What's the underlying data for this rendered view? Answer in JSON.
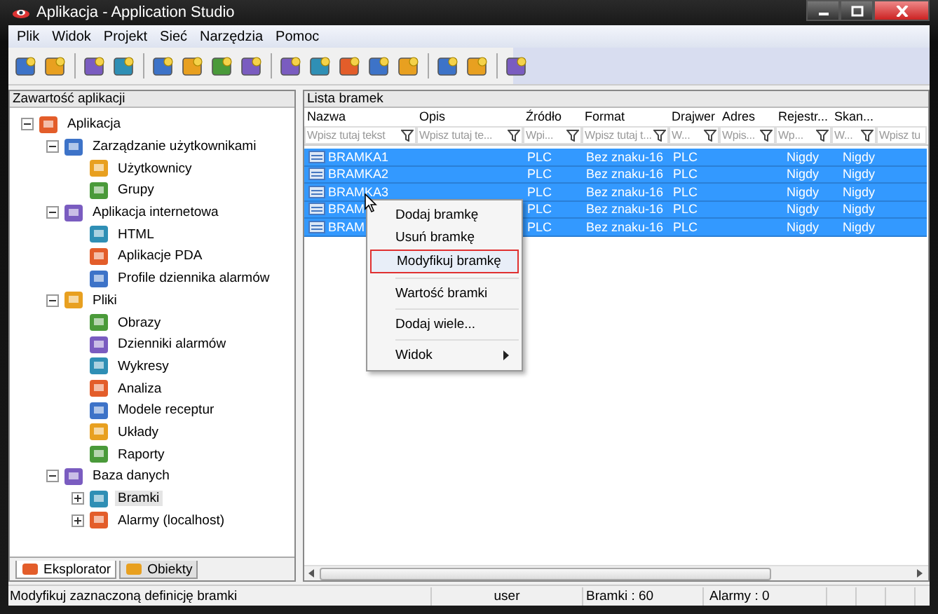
{
  "window": {
    "title": "Aplikacja - Application Studio"
  },
  "menu": [
    "Plik",
    "Widok",
    "Projekt",
    "Sieć",
    "Narzędzia",
    "Pomoc"
  ],
  "explorer": {
    "title": "Zawartość aplikacji",
    "tree": [
      {
        "label": "Aplikacja",
        "expanded": true,
        "selected": false,
        "children": [
          {
            "label": "Zarządzanie użytkownikami",
            "expanded": true,
            "selected": false,
            "children": [
              {
                "label": "Użytkownicy",
                "selected": false
              },
              {
                "label": "Grupy",
                "selected": false
              }
            ]
          },
          {
            "label": "Aplikacja internetowa",
            "expanded": true,
            "selected": false,
            "children": [
              {
                "label": "HTML",
                "selected": false
              },
              {
                "label": "Aplikacje PDA",
                "selected": false
              },
              {
                "label": "Profile dziennika alarmów",
                "selected": false
              }
            ]
          },
          {
            "label": "Pliki",
            "expanded": true,
            "selected": false,
            "children": [
              {
                "label": "Obrazy",
                "selected": false
              },
              {
                "label": "Dzienniki alarmów",
                "selected": false
              },
              {
                "label": "Wykresy",
                "selected": false
              },
              {
                "label": "Analiza",
                "selected": false
              },
              {
                "label": "Modele receptur",
                "selected": false
              },
              {
                "label": "Układy",
                "selected": false
              },
              {
                "label": "Raporty",
                "selected": false
              }
            ]
          },
          {
            "label": "Baza danych",
            "expanded": true,
            "selected": false,
            "children": [
              {
                "label": "Bramki",
                "expanded": false,
                "selected": true
              },
              {
                "label": "Alarmy (localhost)",
                "expanded": false,
                "selected": false
              }
            ]
          }
        ]
      }
    ],
    "tabs": [
      {
        "label": "Eksplorator",
        "selected": true
      },
      {
        "label": "Obiekty",
        "selected": false
      }
    ]
  },
  "grid": {
    "title": "Lista bramek",
    "columns": [
      {
        "label": "Nazwa",
        "placeholder": "Wpisz tutaj tekst"
      },
      {
        "label": "Opis",
        "placeholder": "Wpisz tutaj te..."
      },
      {
        "label": "Źródło",
        "placeholder": "Wpi..."
      },
      {
        "label": "Format",
        "placeholder": "Wpisz tutaj t..."
      },
      {
        "label": "Drajwer",
        "placeholder": "W..."
      },
      {
        "label": "Adres",
        "placeholder": "Wpis..."
      },
      {
        "label": "Rejestr...",
        "placeholder": "Wp..."
      },
      {
        "label": "Skan...",
        "placeholder": "W..."
      },
      {
        "placeholder": "Wpisz tu"
      }
    ],
    "rows": [
      {
        "name": "BRAMKA1",
        "source": "PLC",
        "format": "Bez znaku-16",
        "driver": "PLC",
        "register": "Nigdy",
        "scan": "Nigdy",
        "selected": true
      },
      {
        "name": "BRAMKA2",
        "source": "PLC",
        "format": "Bez znaku-16",
        "driver": "PLC",
        "register": "Nigdy",
        "scan": "Nigdy",
        "selected": true
      },
      {
        "name": "BRAMKA3",
        "source": "PLC",
        "format": "Bez znaku-16",
        "driver": "PLC",
        "register": "Nigdy",
        "scan": "Nigdy",
        "selected": true
      },
      {
        "name": "BRAM",
        "source": "PLC",
        "format": "Bez znaku-16",
        "driver": "PLC",
        "register": "Nigdy",
        "scan": "Nigdy",
        "selected": true
      },
      {
        "name": "BRAM",
        "source": "PLC",
        "format": "Bez znaku-16",
        "driver": "PLC",
        "register": "Nigdy",
        "scan": "Nigdy",
        "selected": true
      }
    ]
  },
  "context_menu": [
    {
      "kind": "item",
      "label": "Dodaj bramkę",
      "selected": false
    },
    {
      "kind": "item",
      "label": "Usuń bramkę",
      "selected": false
    },
    {
      "kind": "item",
      "label": "Modyfikuj bramkę",
      "selected": true
    },
    {
      "kind": "separator"
    },
    {
      "kind": "item",
      "label": "Wartość bramki",
      "selected": false
    },
    {
      "kind": "separator"
    },
    {
      "kind": "item",
      "label": "Dodaj wiele...",
      "selected": false
    },
    {
      "kind": "separator"
    },
    {
      "kind": "submenu",
      "label": "Widok",
      "selected": false
    }
  ],
  "status_bar": {
    "message": "Modyfikuj zaznaczoną definicję bramki",
    "user": "user",
    "gates": "Bramki : 60",
    "alarms": "Alarmy : 0"
  }
}
